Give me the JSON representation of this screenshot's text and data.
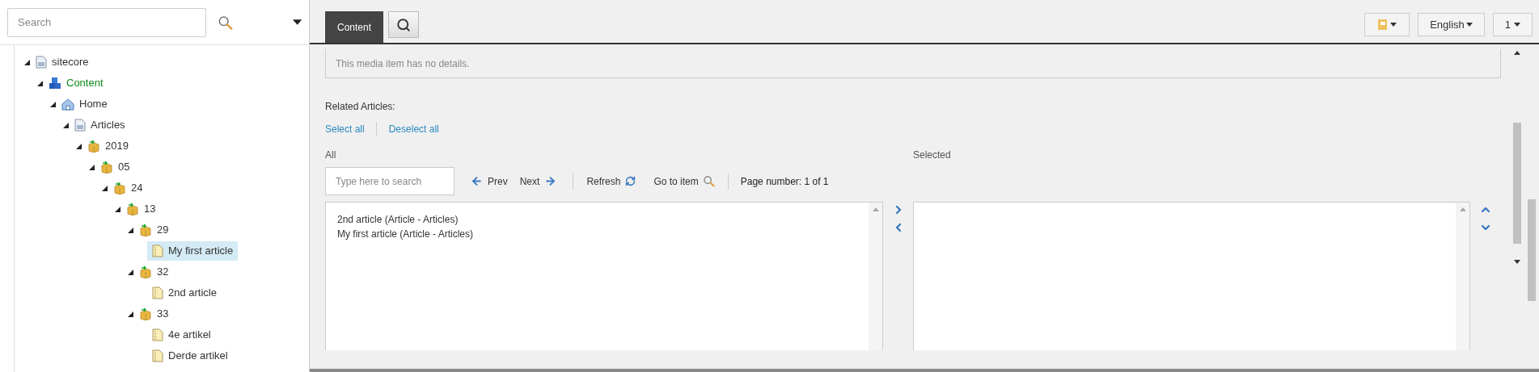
{
  "sidebar": {
    "search": {
      "placeholder": "Search"
    },
    "tree": [
      {
        "label": "sitecore",
        "kind": "document",
        "expanded": true,
        "selected": false,
        "children": [
          {
            "label": "Content",
            "kind": "content",
            "expanded": true,
            "selected": false,
            "children": [
              {
                "label": "Home",
                "kind": "home",
                "expanded": true,
                "selected": false,
                "children": [
                  {
                    "label": "Articles",
                    "kind": "document",
                    "expanded": true,
                    "selected": false,
                    "children": [
                      {
                        "label": "2019",
                        "kind": "folder",
                        "expanded": true,
                        "selected": false,
                        "children": [
                          {
                            "label": "05",
                            "kind": "folder",
                            "expanded": true,
                            "selected": false,
                            "children": [
                              {
                                "label": "24",
                                "kind": "folder",
                                "expanded": true,
                                "selected": false,
                                "children": [
                                  {
                                    "label": "13",
                                    "kind": "folder",
                                    "expanded": true,
                                    "selected": false,
                                    "children": [
                                      {
                                        "label": "29",
                                        "kind": "folder",
                                        "expanded": true,
                                        "selected": false,
                                        "children": [
                                          {
                                            "label": "My first article",
                                            "kind": "article",
                                            "expanded": false,
                                            "selected": true
                                          }
                                        ]
                                      },
                                      {
                                        "label": "32",
                                        "kind": "folder",
                                        "expanded": true,
                                        "selected": false,
                                        "children": [
                                          {
                                            "label": "2nd article",
                                            "kind": "article",
                                            "expanded": false,
                                            "selected": false
                                          }
                                        ]
                                      },
                                      {
                                        "label": "33",
                                        "kind": "folder",
                                        "expanded": true,
                                        "selected": false,
                                        "children": [
                                          {
                                            "label": "4e artikel",
                                            "kind": "article",
                                            "expanded": false,
                                            "selected": false
                                          },
                                          {
                                            "label": "Derde artikel",
                                            "kind": "article",
                                            "expanded": false,
                                            "selected": false
                                          }
                                        ]
                                      }
                                    ]
                                  }
                                ]
                              }
                            ]
                          }
                        ]
                      }
                    ]
                  }
                ]
              }
            ]
          }
        ]
      }
    ]
  },
  "tabs": [
    {
      "kind": "text",
      "label": "Content",
      "selected": true
    },
    {
      "kind": "search",
      "selected": false
    }
  ],
  "toolbar": {
    "language": "English",
    "version": "1"
  },
  "details_message": "This media item has no details.",
  "field": {
    "label": "Related Articles:",
    "select_all": "Select all",
    "deselect_all": "Deselect all",
    "all_label": "All",
    "selected_label": "Selected",
    "search_placeholder": "Type here to search",
    "prev": "Prev",
    "next": "Next",
    "refresh": "Refresh",
    "go_to_item": "Go to item",
    "page_number": "Page number: 1 of 1",
    "all_items": [
      "2nd article (Article - Articles)",
      "My first article (Article - Articles)"
    ]
  }
}
